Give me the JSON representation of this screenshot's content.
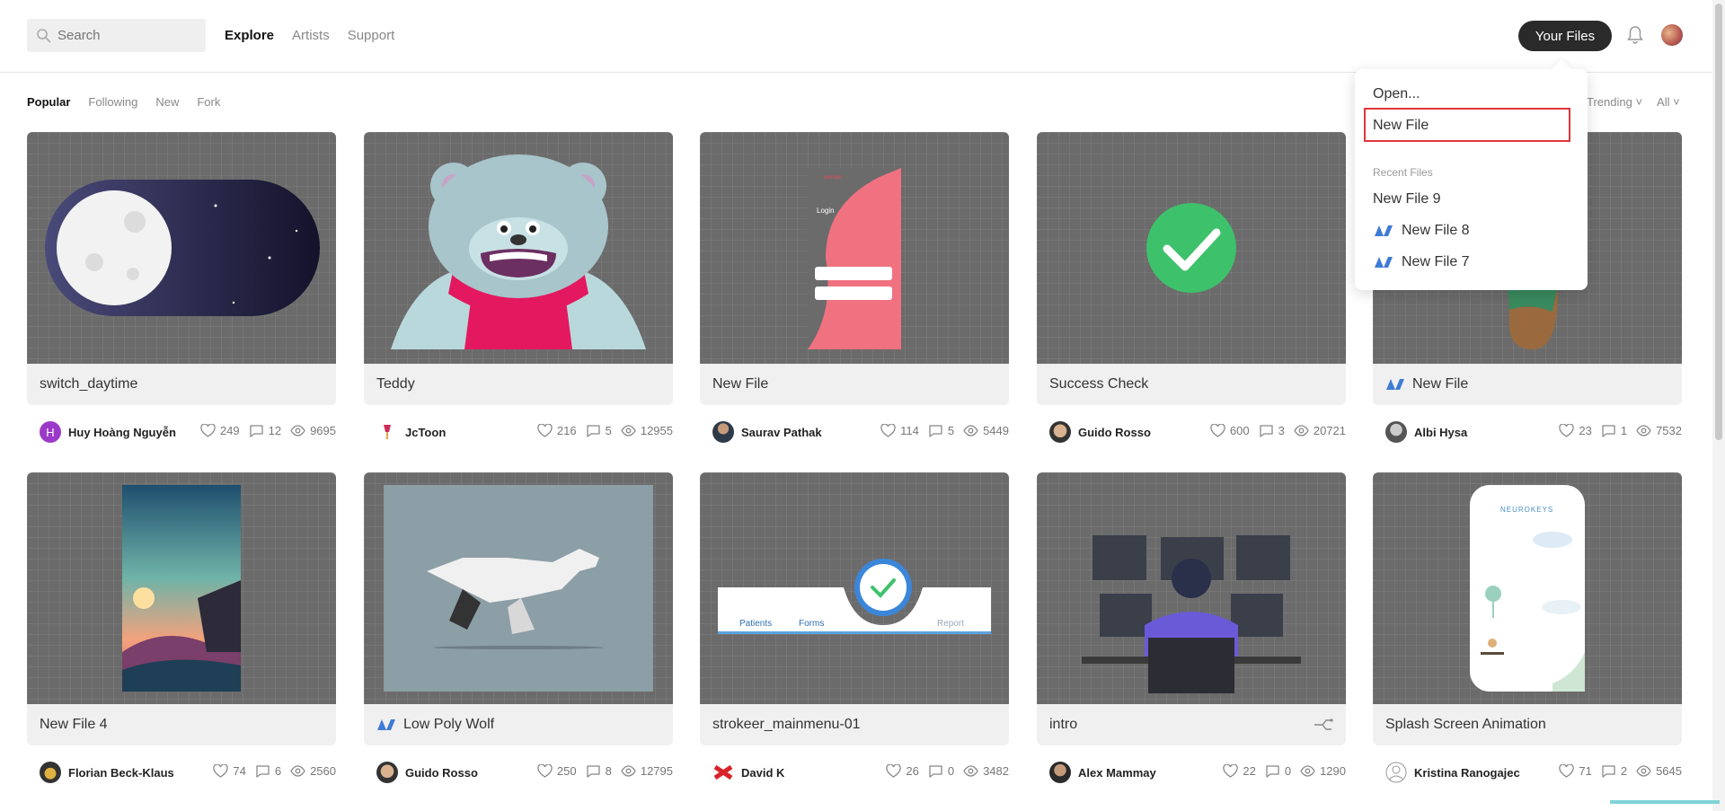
{
  "search": {
    "placeholder": "Search"
  },
  "nav": {
    "explore": "Explore",
    "artists": "Artists",
    "support": "Support"
  },
  "header": {
    "your_files": "Your Files"
  },
  "filters": {
    "popular": "Popular",
    "following": "Following",
    "new": "New",
    "fork": "Fork"
  },
  "sort": {
    "trending": "Trending ˅",
    "all": "All ˅"
  },
  "dropdown": {
    "open": "Open...",
    "new_file": "New File",
    "recent_label": "Recent Files",
    "recent": [
      "New File 9",
      "New File 8",
      "New File 7"
    ]
  },
  "cards": [
    {
      "title": "switch_daytime",
      "author": "Huy Hoàng Nguyễn",
      "avatar_letter": "H",
      "likes": "249",
      "comments": "12",
      "views": "9695"
    },
    {
      "title": "Teddy",
      "author": "JcToon",
      "likes": "216",
      "comments": "5",
      "views": "12955"
    },
    {
      "title": "New File",
      "author": "Saurav Pathak",
      "likes": "114",
      "comments": "5",
      "views": "5449"
    },
    {
      "title": "Success Check",
      "author": "Guido Rosso",
      "likes": "600",
      "comments": "3",
      "views": "20721"
    },
    {
      "title": "New File",
      "author": "Albi Hysa",
      "likes": "23",
      "comments": "1",
      "views": "7532"
    },
    {
      "title": "New File 4",
      "author": "Florian Beck-Klaus",
      "likes": "74",
      "comments": "6",
      "views": "2560"
    },
    {
      "title": "Low Poly Wolf",
      "author": "Guido Rosso",
      "likes": "250",
      "comments": "8",
      "views": "12795"
    },
    {
      "title": "strokeer_mainmenu-01",
      "author": "David K",
      "likes": "26",
      "comments": "0",
      "views": "3482",
      "thumb_labels": [
        "Patients",
        "Forms",
        "Report"
      ]
    },
    {
      "title": "intro",
      "author": "Alex Mammay",
      "likes": "22",
      "comments": "0",
      "views": "1290"
    },
    {
      "title": "Splash Screen Animation",
      "author": "Kristina Ranogajec",
      "likes": "71",
      "comments": "2",
      "views": "5645",
      "thumb_text": "NEUROKEYS"
    }
  ],
  "login_thumb": {
    "heading": "Login",
    "brand": "enchan"
  },
  "colors": {
    "accent": "#2a2a2a",
    "highlight": "#e0363a",
    "success": "#3ec16b"
  }
}
